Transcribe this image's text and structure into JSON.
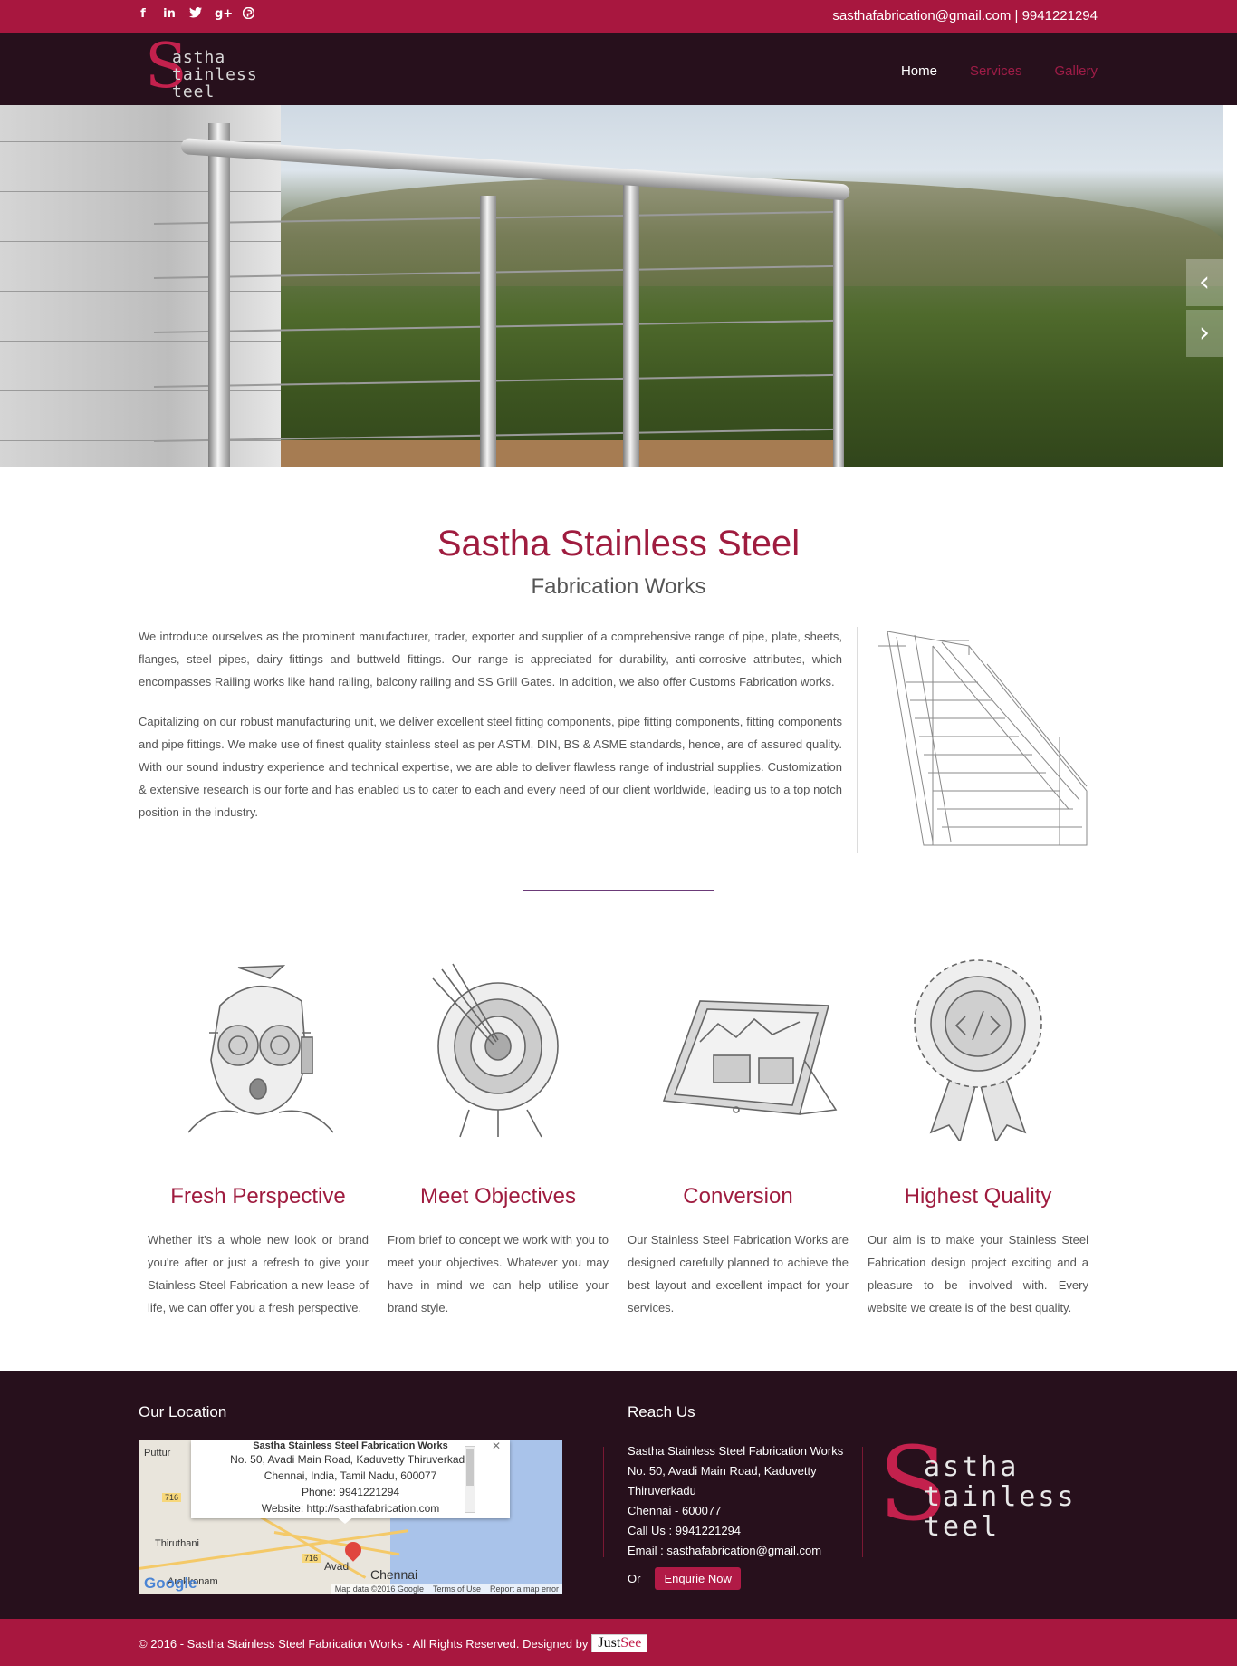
{
  "topbar": {
    "social": [
      {
        "icon": "facebook-icon",
        "glyph": "f"
      },
      {
        "icon": "linkedin-icon",
        "glyph": "in"
      },
      {
        "icon": "twitter-icon",
        "glyph": "✉"
      },
      {
        "icon": "google-plus-icon",
        "glyph": "g+"
      },
      {
        "icon": "pinterest-icon",
        "glyph": "℗"
      }
    ],
    "contact": "sasthafabrication@gmail.com  |  9941221294"
  },
  "logo": {
    "letter": "S",
    "lines": [
      "astha",
      "tainless",
      "teel"
    ]
  },
  "nav": {
    "home": "Home",
    "services": "Services",
    "gallery": "Gallery"
  },
  "intro": {
    "title": "Sastha Stainless Steel",
    "subtitle": "Fabrication Works",
    "paragraph1": "We introduce ourselves as the prominent manufacturer, trader, exporter and supplier of a comprehensive range of pipe, plate, sheets, flanges, steel pipes, dairy fittings and buttweld fittings. Our range is appreciated for durability, anti-corrosive attributes, which encompasses Railing works like hand railing, balcony railing and SS Grill Gates. In addition, we also offer Customs Fabrication works.",
    "paragraph2": "Capitalizing on our robust manufacturing unit, we deliver excellent steel fitting components, pipe fitting components, fitting components and pipe fittings. We make use of finest quality stainless steel as per ASTM, DIN, BS & ASME standards, hence, are of assured quality. With our sound industry experience and technical expertise, we are able to deliver flawless range of industrial supplies. Customization & extensive research is our forte and has enabled us to cater to each and every need of our client worldwide, leading us to a top notch position in the industry."
  },
  "features": [
    {
      "title": "Fresh Perspective",
      "text": "Whether it's a whole new look or brand you're after or just a refresh to give your Stainless Steel Fabrication a new lease of life, we can offer you a fresh perspective."
    },
    {
      "title": "Meet Objectives",
      "text": "From brief to concept we work with you to meet your objectives. Whatever you may have in mind we can help utilise your brand style."
    },
    {
      "title": "Conversion",
      "text": "Our Stainless Steel Fabrication Works are designed carefully planned to achieve the best layout and excellent impact for your services."
    },
    {
      "title": "Highest Quality",
      "text": "Our aim is to make your Stainless Steel Fabrication design project exciting and a pleasure to be involved with. Every website we create is of the best quality."
    }
  ],
  "footer": {
    "location_heading": "Our Location",
    "map": {
      "popup_name": "Sastha Stainless Steel Fabrication Works",
      "popup_address": "No. 50, Avadi Main Road, Kaduvetty Thiruverkadu",
      "popup_city": "Chennai, India, Tamil Nadu, 600077",
      "popup_phone": "Phone: 9941221294",
      "popup_website": "Website: http://sasthafabrication.com",
      "places": [
        "Puttur",
        "Thiruthani",
        "Arakkonam",
        "Avadi",
        "Chennai"
      ],
      "badge1": "716",
      "badge2": "716",
      "google": "Google",
      "attr_data": "Map data ©2016 Google",
      "attr_terms": "Terms of Use",
      "attr_report": "Report a map error"
    },
    "reach_heading": "Reach Us",
    "reach_lines": [
      "Sastha Stainless Steel Fabrication Works",
      "No. 50, Avadi Main Road, Kaduvetty",
      "Thiruverkadu",
      "Chennai - 600077",
      "Call Us : 9941221294",
      "Email : sasthafabrication@gmail.com"
    ],
    "or_label": "Or",
    "enquire_label": "Enqurie Now"
  },
  "bottom": {
    "copyright": "© 2016 - Sastha Stainless Steel Fabrication Works - All Rights Reserved. Designed by",
    "designer_a": "Just",
    "designer_b": "See"
  },
  "colors": {
    "brand": "#a8173f",
    "dark": "#27101c",
    "accent_text": "#9f1c3f"
  }
}
